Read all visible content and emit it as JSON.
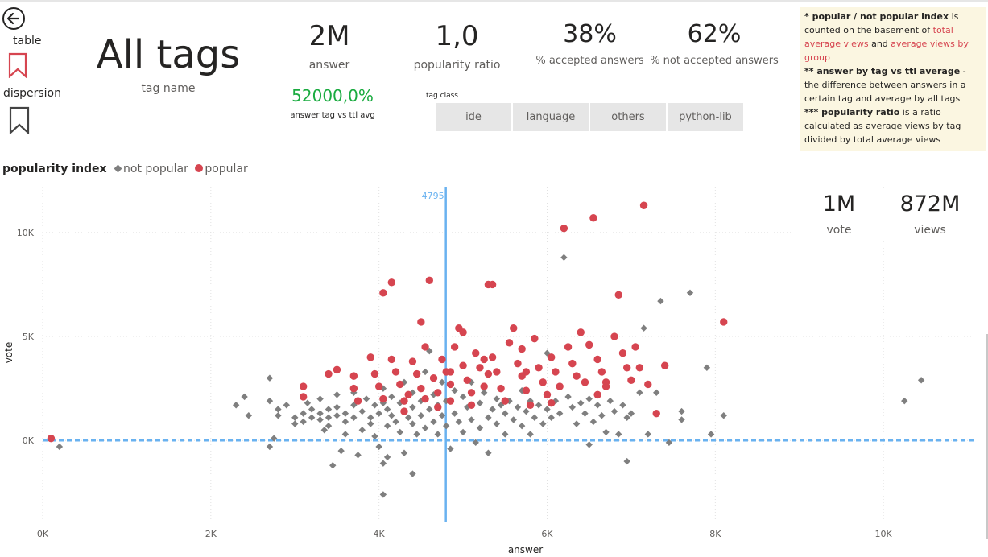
{
  "nav": {
    "table_label": "table",
    "dispersion_label": "dispersion"
  },
  "header": {
    "title": "All tags",
    "subtitle": "tag name"
  },
  "kpis": {
    "answer": {
      "value": "2M",
      "label": "answer"
    },
    "popularity_ratio": {
      "value": "1,0",
      "label": "popularity ratio"
    },
    "accepted": {
      "value": "38%",
      "label": "% accepted answers"
    },
    "not_accepted": {
      "value": "62%",
      "label": "% not accepted answers"
    },
    "answer_vs_avg": {
      "value": "52000,0%",
      "label": "answer tag vs ttl avg"
    },
    "vote": {
      "value": "1M",
      "label": "vote"
    },
    "views": {
      "value": "872M",
      "label": "views"
    }
  },
  "slicer": {
    "title": "tag class",
    "options": [
      "ide",
      "language",
      "others",
      "python-lib"
    ]
  },
  "notes": {
    "n1_bold": "* popular / not popular index",
    "n1_text": " is counted on the basement of ",
    "n1_red1": "total average views",
    "n1_and": " and ",
    "n1_red2": "average views by group",
    "n2_bold": "** answer by tag vs ttl average",
    "n2_text": " - the difference between answers in a certain tag and average by all tags",
    "n3_bold": "*** popularity ratio",
    "n3_text": " is a ratio calculated as average views by tag divided by total average views"
  },
  "legend": {
    "title": "popularity index",
    "items": [
      "not popular",
      "popular"
    ]
  },
  "colors": {
    "popular": "#d64550",
    "not_popular": "#7f7f7f",
    "reference_line": "#69b2f0",
    "positive_kpi": "#1aab40"
  },
  "chart_data": {
    "type": "scatter",
    "xlabel": "answer",
    "ylabel": "vote",
    "xlim": [
      0,
      11100
    ],
    "ylim": [
      -3900,
      12200
    ],
    "x_ticks": [
      0,
      2000,
      4000,
      6000,
      8000,
      10000
    ],
    "x_tick_labels": [
      "0K",
      "2K",
      "4K",
      "6K",
      "8K",
      "10K"
    ],
    "y_ticks": [
      0,
      5000,
      10000
    ],
    "y_tick_labels": [
      "0K",
      "5K",
      "10K"
    ],
    "grid": true,
    "reference_x": 4795,
    "reference_x_label": "4795",
    "reference_y": 0,
    "series": [
      {
        "name": "not popular",
        "marker": "diamond",
        "points": [
          [
            200,
            -300
          ],
          [
            2300,
            1700
          ],
          [
            2400,
            2100
          ],
          [
            2450,
            1200
          ],
          [
            2700,
            3000
          ],
          [
            2700,
            1900
          ],
          [
            2750,
            100
          ],
          [
            2700,
            -300
          ],
          [
            2800,
            1500
          ],
          [
            2800,
            1200
          ],
          [
            2900,
            1700
          ],
          [
            3000,
            1100
          ],
          [
            3000,
            800
          ],
          [
            3100,
            1300
          ],
          [
            3100,
            900
          ],
          [
            3150,
            1800
          ],
          [
            3200,
            1500
          ],
          [
            3200,
            1100
          ],
          [
            3300,
            2000
          ],
          [
            3300,
            1300
          ],
          [
            3300,
            1000
          ],
          [
            3350,
            500
          ],
          [
            3400,
            1500
          ],
          [
            3400,
            1100
          ],
          [
            3400,
            700
          ],
          [
            3500,
            2200
          ],
          [
            3500,
            1600
          ],
          [
            3500,
            1200
          ],
          [
            3450,
            -1200
          ],
          [
            3550,
            -500
          ],
          [
            3600,
            1300
          ],
          [
            3600,
            900
          ],
          [
            3600,
            300
          ],
          [
            3700,
            2300
          ],
          [
            3700,
            1700
          ],
          [
            3700,
            1100
          ],
          [
            3750,
            -700
          ],
          [
            3800,
            1400
          ],
          [
            3800,
            500
          ],
          [
            3850,
            2000
          ],
          [
            3900,
            1100
          ],
          [
            3900,
            800
          ],
          [
            3950,
            1700
          ],
          [
            3950,
            200
          ],
          [
            4000,
            1300
          ],
          [
            4000,
            -300
          ],
          [
            4050,
            2500
          ],
          [
            4050,
            1800
          ],
          [
            4050,
            -1100
          ],
          [
            4100,
            1500
          ],
          [
            4100,
            700
          ],
          [
            4150,
            2100
          ],
          [
            4150,
            1200
          ],
          [
            4200,
            900
          ],
          [
            4250,
            1800
          ],
          [
            4250,
            400
          ],
          [
            4300,
            2800
          ],
          [
            4300,
            1400
          ],
          [
            4300,
            -600
          ],
          [
            4350,
            1100
          ],
          [
            4400,
            2300
          ],
          [
            4400,
            1600
          ],
          [
            4400,
            800
          ],
          [
            4450,
            300
          ],
          [
            4500,
            1900
          ],
          [
            4500,
            1200
          ],
          [
            4550,
            3300
          ],
          [
            4550,
            600
          ],
          [
            4600,
            4300
          ],
          [
            4600,
            1500
          ],
          [
            4650,
            2200
          ],
          [
            4650,
            900
          ],
          [
            4700,
            1700
          ],
          [
            4700,
            300
          ],
          [
            4750,
            2800
          ],
          [
            4750,
            1200
          ],
          [
            4800,
            1900
          ],
          [
            4800,
            700
          ],
          [
            4850,
            -400
          ],
          [
            4900,
            2400
          ],
          [
            4900,
            1300
          ],
          [
            4950,
            900
          ],
          [
            5000,
            2100
          ],
          [
            5000,
            400
          ],
          [
            5050,
            1600
          ],
          [
            5100,
            2800
          ],
          [
            5100,
            1000
          ],
          [
            5150,
            -100
          ],
          [
            5200,
            1800
          ],
          [
            5200,
            600
          ],
          [
            5250,
            2300
          ],
          [
            5300,
            1100
          ],
          [
            5300,
            -600
          ],
          [
            5350,
            1500
          ],
          [
            5400,
            2000
          ],
          [
            5400,
            800
          ],
          [
            5450,
            1700
          ],
          [
            5500,
            1300
          ],
          [
            5500,
            300
          ],
          [
            5550,
            1900
          ],
          [
            5600,
            1000
          ],
          [
            5650,
            1600
          ],
          [
            5700,
            2400
          ],
          [
            5700,
            700
          ],
          [
            5750,
            1400
          ],
          [
            5800,
            1900
          ],
          [
            5800,
            300
          ],
          [
            5850,
            1100
          ],
          [
            5900,
            1700
          ],
          [
            5950,
            800
          ],
          [
            6000,
            1500
          ],
          [
            6000,
            4200
          ],
          [
            6050,
            1100
          ],
          [
            6100,
            1900
          ],
          [
            6150,
            1300
          ],
          [
            6200,
            8800
          ],
          [
            6250,
            2100
          ],
          [
            6300,
            1600
          ],
          [
            6350,
            800
          ],
          [
            6400,
            1800
          ],
          [
            6450,
            1300
          ],
          [
            6500,
            2000
          ],
          [
            6500,
            -200
          ],
          [
            6550,
            900
          ],
          [
            6600,
            1700
          ],
          [
            6650,
            1200
          ],
          [
            6700,
            400
          ],
          [
            6750,
            1900
          ],
          [
            6800,
            1400
          ],
          [
            6850,
            300
          ],
          [
            6900,
            1700
          ],
          [
            6950,
            1100
          ],
          [
            6950,
            -1000
          ],
          [
            7000,
            1300
          ],
          [
            7100,
            2300
          ],
          [
            7150,
            5400
          ],
          [
            7200,
            300
          ],
          [
            7300,
            2300
          ],
          [
            7350,
            6700
          ],
          [
            7450,
            -100
          ],
          [
            7600,
            1400
          ],
          [
            7600,
            1000
          ],
          [
            7700,
            7100
          ],
          [
            7900,
            3500
          ],
          [
            7950,
            300
          ],
          [
            8100,
            1200
          ],
          [
            10250,
            1900
          ],
          [
            10450,
            2900
          ],
          [
            4400,
            -1600
          ],
          [
            4100,
            -800
          ],
          [
            4050,
            -2600
          ]
        ]
      },
      {
        "name": "popular",
        "marker": "circle",
        "points": [
          [
            100,
            100
          ],
          [
            3100,
            2600
          ],
          [
            3100,
            2100
          ],
          [
            3400,
            3200
          ],
          [
            3500,
            3400
          ],
          [
            3700,
            3100
          ],
          [
            3700,
            2500
          ],
          [
            3750,
            1900
          ],
          [
            3900,
            4000
          ],
          [
            3950,
            3200
          ],
          [
            4000,
            2600
          ],
          [
            4050,
            2000
          ],
          [
            4050,
            7100
          ],
          [
            4150,
            7600
          ],
          [
            4150,
            3900
          ],
          [
            4200,
            3300
          ],
          [
            4250,
            2700
          ],
          [
            4300,
            1900
          ],
          [
            4300,
            1400
          ],
          [
            4400,
            3800
          ],
          [
            4450,
            3200
          ],
          [
            4500,
            2500
          ],
          [
            4500,
            5700
          ],
          [
            4550,
            4500
          ],
          [
            4550,
            2000
          ],
          [
            4600,
            7700
          ],
          [
            4650,
            3000
          ],
          [
            4700,
            2300
          ],
          [
            4700,
            1600
          ],
          [
            4750,
            3900
          ],
          [
            4800,
            3300
          ],
          [
            4850,
            2700
          ],
          [
            4850,
            1900
          ],
          [
            4900,
            4500
          ],
          [
            4950,
            5400
          ],
          [
            5000,
            5200
          ],
          [
            5000,
            3600
          ],
          [
            5050,
            2900
          ],
          [
            5100,
            2300
          ],
          [
            5100,
            1700
          ],
          [
            5150,
            4200
          ],
          [
            5200,
            3500
          ],
          [
            5250,
            2600
          ],
          [
            5300,
            7500
          ],
          [
            5350,
            7500
          ],
          [
            5350,
            4000
          ],
          [
            5400,
            3300
          ],
          [
            5450,
            2500
          ],
          [
            5500,
            1900
          ],
          [
            5550,
            4700
          ],
          [
            5600,
            5400
          ],
          [
            5650,
            3700
          ],
          [
            5700,
            3100
          ],
          [
            5750,
            2400
          ],
          [
            5800,
            1700
          ],
          [
            5850,
            4900
          ],
          [
            5900,
            3500
          ],
          [
            5950,
            2800
          ],
          [
            6000,
            2200
          ],
          [
            6050,
            4000
          ],
          [
            6100,
            3300
          ],
          [
            6150,
            2600
          ],
          [
            6200,
            10200
          ],
          [
            6250,
            4500
          ],
          [
            6300,
            3700
          ],
          [
            6350,
            3100
          ],
          [
            6400,
            5200
          ],
          [
            6450,
            2800
          ],
          [
            6500,
            4600
          ],
          [
            6550,
            10700
          ],
          [
            6600,
            3900
          ],
          [
            6650,
            3300
          ],
          [
            6700,
            2600
          ],
          [
            6800,
            5000
          ],
          [
            6850,
            7000
          ],
          [
            6900,
            4200
          ],
          [
            6950,
            3500
          ],
          [
            7000,
            2900
          ],
          [
            7050,
            4500
          ],
          [
            7100,
            3500
          ],
          [
            7150,
            11300
          ],
          [
            7200,
            2700
          ],
          [
            7300,
            1300
          ],
          [
            7400,
            3600
          ],
          [
            8100,
            5700
          ],
          [
            5250,
            3900
          ],
          [
            5300,
            3200
          ],
          [
            5700,
            4400
          ],
          [
            5750,
            3300
          ],
          [
            4850,
            3300
          ],
          [
            4350,
            2200
          ],
          [
            6050,
            1800
          ],
          [
            6600,
            2200
          ],
          [
            6700,
            2800
          ]
        ]
      }
    ]
  }
}
